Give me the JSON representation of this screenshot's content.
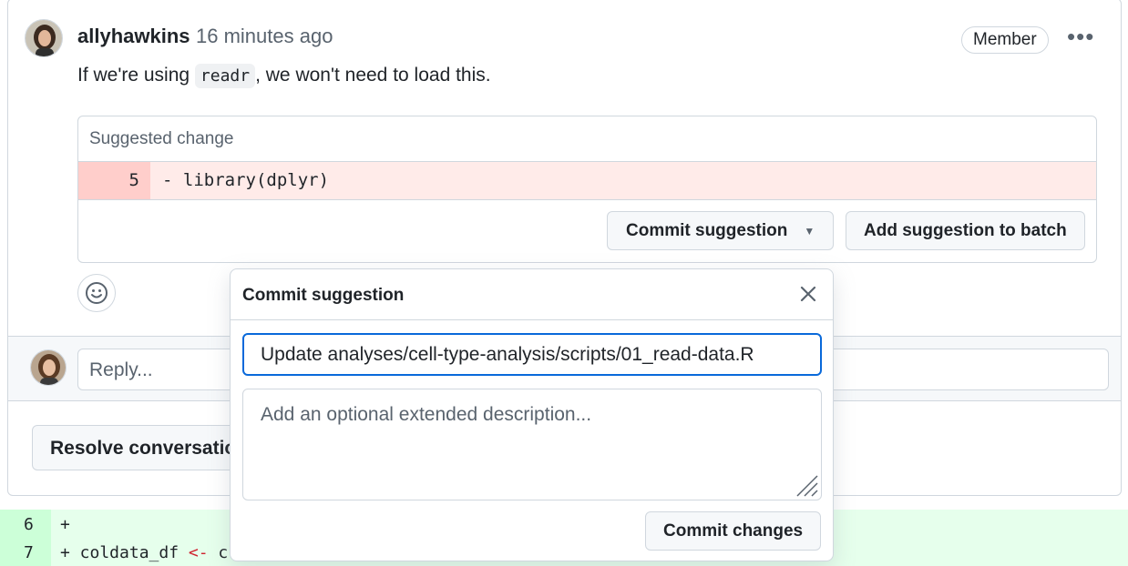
{
  "comment": {
    "author": "allyhawkins",
    "time": "16 minutes ago",
    "role_badge": "Member",
    "more_icon": "kebab-horizontal-icon",
    "body_prefix": "If we're using ",
    "body_code": "readr",
    "body_suffix": ", we won't need to load this."
  },
  "suggestion": {
    "header": "Suggested change",
    "line_number": "5",
    "line_code": "- library(dplyr)",
    "commit_button": "Commit suggestion",
    "batch_button": "Add suggestion to batch"
  },
  "reply": {
    "placeholder": "Reply..."
  },
  "resolve_button": "Resolve conversation",
  "diff_lines": [
    {
      "num": "6",
      "code": "+"
    },
    {
      "num": "7",
      "code_pre": "+ coldata_df ",
      "code_op": "<-",
      "code_post": " c"
    }
  ],
  "popover": {
    "title": "Commit suggestion",
    "message_value": "Update analyses/cell-type-analysis/scripts/01_read-data.R",
    "description_placeholder": "Add an optional extended description...",
    "commit_button": "Commit changes"
  },
  "colors": {
    "accent": "#0969da",
    "deleted_bg": "#ffebe9",
    "added_bg": "#e6ffec"
  }
}
